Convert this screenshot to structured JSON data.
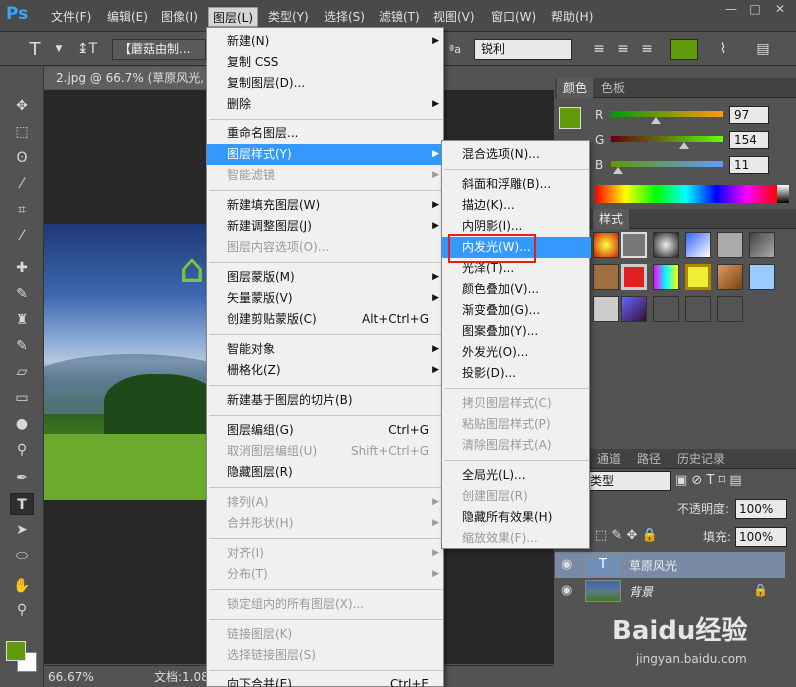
{
  "app": {
    "logo": "Ps"
  },
  "menubar": {
    "items": [
      "文件(F)",
      "编辑(E)",
      "图像(I)",
      "图层(L)",
      "类型(Y)",
      "选择(S)",
      "滤镜(T)",
      "视图(V)",
      "窗口(W)",
      "帮助(H)"
    ],
    "window_controls": [
      "—",
      "□",
      "✕"
    ]
  },
  "options": {
    "font_family": "【蘑菇由制...",
    "aa_label": "ªa",
    "antialias": "锐利",
    "color": "#619a0b"
  },
  "document": {
    "tab_title": "2.jpg @ 66.7% (草原风光, R",
    "zoom": "66.67%",
    "doc_size": "文档:1.08"
  },
  "color_panel": {
    "tabs": [
      "颜色",
      "色板"
    ],
    "r": {
      "label": "R",
      "value": "97"
    },
    "g": {
      "label": "G",
      "value": "154"
    },
    "b": {
      "label": "B",
      "value": "11"
    },
    "fg": "#619a0b"
  },
  "styles_panel": {
    "tabs": [
      "样式"
    ]
  },
  "layers_panel": {
    "tabs": [
      "通道",
      "路径",
      "历史记录"
    ],
    "kind_label": "类型",
    "opacity_label": "不透明度:",
    "opacity_value": "100%",
    "fill_label": "填充:",
    "fill_value": "100%",
    "layers": [
      {
        "name": "草原风光",
        "selected": true
      },
      {
        "name": "背景",
        "selected": false
      }
    ]
  },
  "layer_menu": {
    "items": [
      {
        "label": "新建(N)",
        "submenu": true
      },
      {
        "label": "复制 CSS"
      },
      {
        "label": "复制图层(D)..."
      },
      {
        "label": "删除",
        "submenu": true
      },
      {
        "label": "重命名图层..."
      },
      {
        "label": "图层样式(Y)",
        "submenu": true,
        "highlight": true
      },
      {
        "label": "智能滤镜",
        "submenu": true,
        "disabled": true
      },
      {
        "label": "新建填充图层(W)",
        "submenu": true
      },
      {
        "label": "新建调整图层(J)",
        "submenu": true
      },
      {
        "label": "图层内容选项(O)...",
        "disabled": true
      },
      {
        "label": "图层蒙版(M)",
        "submenu": true
      },
      {
        "label": "矢量蒙版(V)",
        "submenu": true
      },
      {
        "label": "创建剪贴蒙版(C)",
        "shortcut": "Alt+Ctrl+G"
      },
      {
        "label": "智能对象",
        "submenu": true
      },
      {
        "label": "栅格化(Z)",
        "submenu": true
      },
      {
        "label": "新建基于图层的切片(B)"
      },
      {
        "label": "图层编组(G)",
        "shortcut": "Ctrl+G"
      },
      {
        "label": "取消图层编组(U)",
        "shortcut": "Shift+Ctrl+G",
        "disabled": true
      },
      {
        "label": "隐藏图层(R)"
      },
      {
        "label": "排列(A)",
        "submenu": true,
        "disabled": true
      },
      {
        "label": "合并形状(H)",
        "submenu": true,
        "disabled": true
      },
      {
        "label": "对齐(I)",
        "submenu": true,
        "disabled": true
      },
      {
        "label": "分布(T)",
        "submenu": true,
        "disabled": true
      },
      {
        "label": "锁定组内的所有图层(X)...",
        "disabled": true
      },
      {
        "label": "链接图层(K)",
        "disabled": true
      },
      {
        "label": "选择链接图层(S)",
        "disabled": true
      },
      {
        "label": "向下合并(E)",
        "shortcut": "Ctrl+E"
      }
    ]
  },
  "style_submenu": {
    "items": [
      {
        "label": "混合选项(N)..."
      },
      {
        "label": "斜面和浮雕(B)..."
      },
      {
        "label": "描边(K)..."
      },
      {
        "label": "内阴影(I)..."
      },
      {
        "label": "内发光(W)...",
        "highlight": true
      },
      {
        "label": "光泽(T)..."
      },
      {
        "label": "颜色叠加(V)..."
      },
      {
        "label": "渐变叠加(G)..."
      },
      {
        "label": "图案叠加(Y)..."
      },
      {
        "label": "外发光(O)..."
      },
      {
        "label": "投影(D)..."
      },
      {
        "label": "拷贝图层样式(C)",
        "disabled": true
      },
      {
        "label": "粘贴图层样式(P)",
        "disabled": true
      },
      {
        "label": "清除图层样式(A)",
        "disabled": true
      },
      {
        "label": "全局光(L)..."
      },
      {
        "label": "创建图层(R)",
        "disabled": true
      },
      {
        "label": "隐藏所有效果(H)"
      },
      {
        "label": "缩放效果(F)...",
        "disabled": true
      }
    ]
  },
  "watermark": {
    "brand": "Baidu经验",
    "url": "jingyan.baidu.com"
  }
}
